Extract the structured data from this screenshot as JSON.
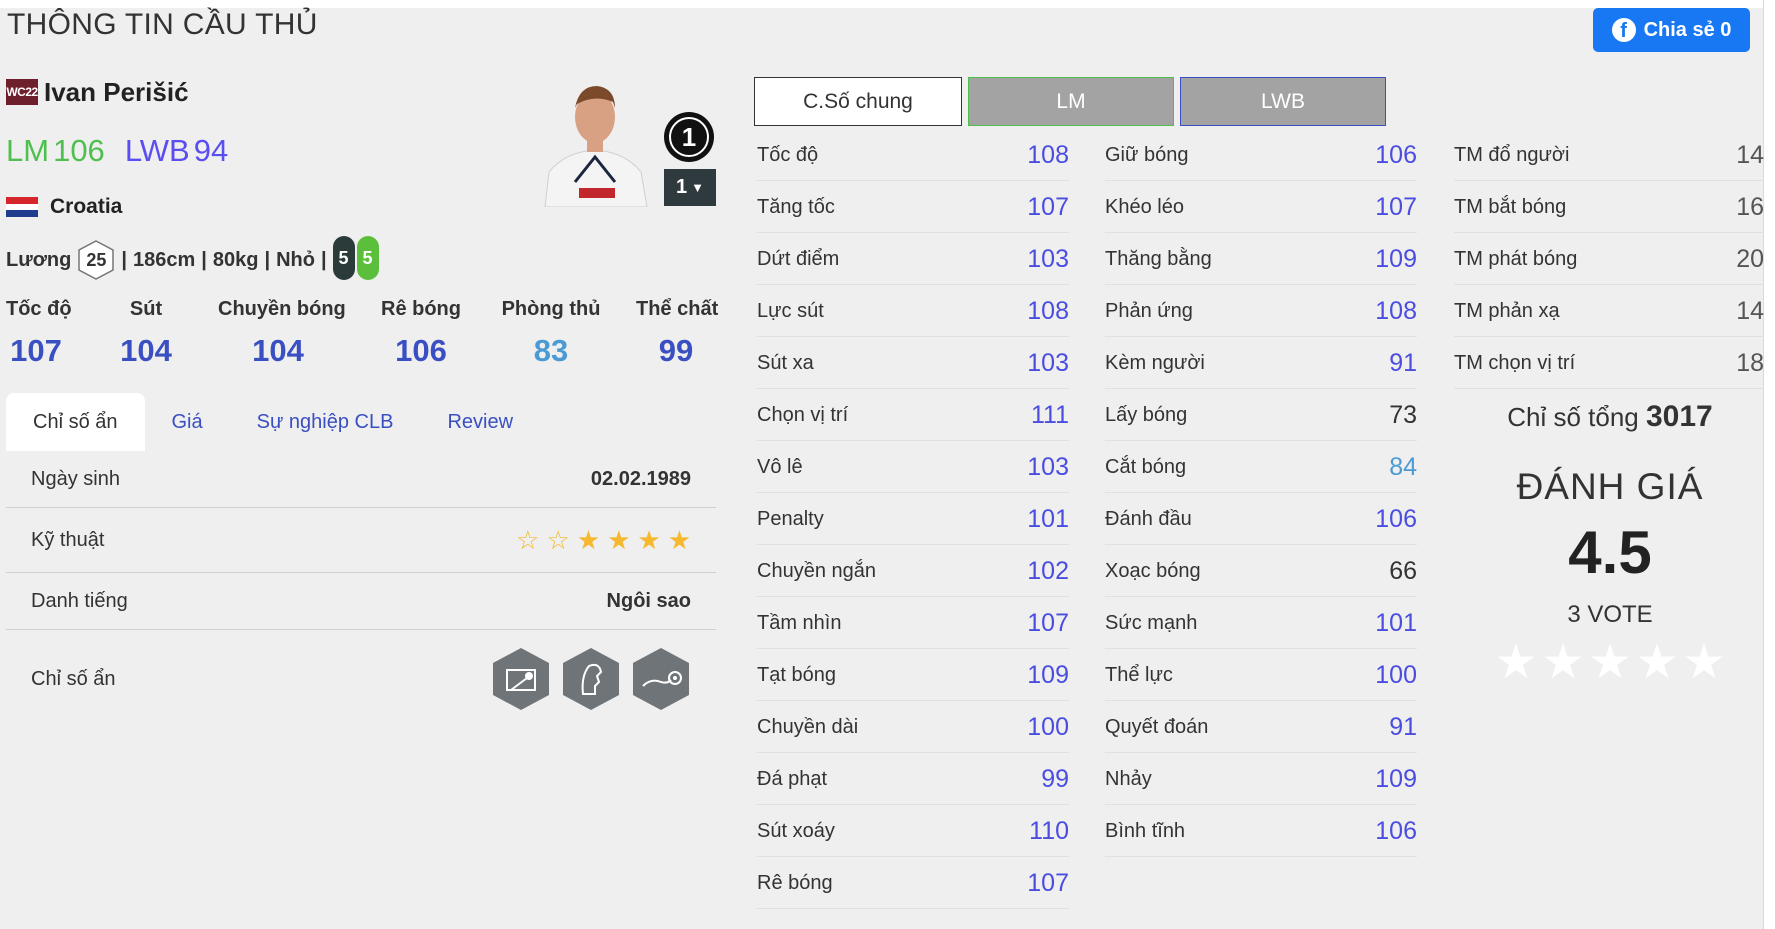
{
  "page_title": "THÔNG TIN CẦU THỦ",
  "share": {
    "label": "Chia sẻ 0"
  },
  "player": {
    "season": "WC22",
    "name": "Ivan Perišić",
    "positions": [
      {
        "pos": "LM",
        "rating": "106",
        "color": "#4fc04f"
      },
      {
        "pos": "LWB",
        "rating": "94",
        "color": "#5b4ef0"
      }
    ],
    "nation": "Croatia",
    "salary_label": "Lương",
    "salary": "25",
    "height": "186cm",
    "weight": "80kg",
    "body": "Nhỏ",
    "sep": "|",
    "foot_left": "5",
    "foot_right": "5",
    "rank": "1",
    "level": "1"
  },
  "main_stats": [
    {
      "label": "Tốc độ",
      "value": "107",
      "color": "#3a4fc1"
    },
    {
      "label": "Sút",
      "value": "104",
      "color": "#3a4fc1"
    },
    {
      "label": "Chuyền bóng",
      "value": "104",
      "color": "#3a4fc1"
    },
    {
      "label": "Rê bóng",
      "value": "106",
      "color": "#3a4fc1"
    },
    {
      "label": "Phòng thủ",
      "value": "83",
      "color": "#4a9ad4"
    },
    {
      "label": "Thể chất",
      "value": "99",
      "color": "#3a4fc1"
    }
  ],
  "tabs": [
    "Chỉ số ẩn",
    "Giá",
    "Sự nghiệp CLB",
    "Review"
  ],
  "info": {
    "birth_label": "Ngày sinh",
    "birth": "02.02.1989",
    "skill_label": "Kỹ thuật",
    "skill_stars": 6,
    "skill_filled": 4,
    "fame_label": "Danh tiếng",
    "fame": "Ngôi sao",
    "hidden_label": "Chỉ số ẩn"
  },
  "pos_tabs": [
    "C.Số chung",
    "LM",
    "LWB"
  ],
  "stats_col1": [
    {
      "label": "Tốc độ",
      "value": "108",
      "color": "#4a4de0"
    },
    {
      "label": "Tăng tốc",
      "value": "107",
      "color": "#4a4de0"
    },
    {
      "label": "Dứt điểm",
      "value": "103",
      "color": "#4a4de0"
    },
    {
      "label": "Lực sút",
      "value": "108",
      "color": "#4a4de0"
    },
    {
      "label": "Sút xa",
      "value": "103",
      "color": "#4a4de0"
    },
    {
      "label": "Chọn vị trí",
      "value": "111",
      "color": "#4a4de0"
    },
    {
      "label": "Vô lê",
      "value": "103",
      "color": "#4a4de0"
    },
    {
      "label": "Penalty",
      "value": "101",
      "color": "#4a4de0"
    },
    {
      "label": "Chuyền ngắn",
      "value": "102",
      "color": "#4a4de0"
    },
    {
      "label": "Tầm nhìn",
      "value": "107",
      "color": "#4a4de0"
    },
    {
      "label": "Tạt bóng",
      "value": "109",
      "color": "#4a4de0"
    },
    {
      "label": "Chuyền dài",
      "value": "100",
      "color": "#4a4de0"
    },
    {
      "label": "Đá phạt",
      "value": "99",
      "color": "#4a4de0"
    },
    {
      "label": "Sút xoáy",
      "value": "110",
      "color": "#4a4de0"
    },
    {
      "label": "Rê bóng",
      "value": "107",
      "color": "#4a4de0"
    }
  ],
  "stats_col2": [
    {
      "label": "Giữ bóng",
      "value": "106",
      "color": "#4a4de0"
    },
    {
      "label": "Khéo léo",
      "value": "107",
      "color": "#4a4de0"
    },
    {
      "label": "Thăng bằng",
      "value": "109",
      "color": "#4a4de0"
    },
    {
      "label": "Phản ứng",
      "value": "108",
      "color": "#4a4de0"
    },
    {
      "label": "Kèm người",
      "value": "91",
      "color": "#4a4de0"
    },
    {
      "label": "Lấy bóng",
      "value": "73",
      "color": "#333333"
    },
    {
      "label": "Cắt bóng",
      "value": "84",
      "color": "#4a9ad4"
    },
    {
      "label": "Đánh đầu",
      "value": "106",
      "color": "#4a4de0"
    },
    {
      "label": "Xoạc bóng",
      "value": "66",
      "color": "#333333"
    },
    {
      "label": "Sức mạnh",
      "value": "101",
      "color": "#4a4de0"
    },
    {
      "label": "Thể lực",
      "value": "100",
      "color": "#4a4de0"
    },
    {
      "label": "Quyết đoán",
      "value": "91",
      "color": "#4a4de0"
    },
    {
      "label": "Nhảy",
      "value": "109",
      "color": "#4a4de0"
    },
    {
      "label": "Bình tĩnh",
      "value": "106",
      "color": "#4a4de0"
    }
  ],
  "stats_col3": [
    {
      "label": "TM đổ người",
      "value": "14",
      "color": "#555555"
    },
    {
      "label": "TM bắt bóng",
      "value": "16",
      "color": "#555555"
    },
    {
      "label": "TM phát bóng",
      "value": "20",
      "color": "#555555"
    },
    {
      "label": "TM phản xạ",
      "value": "14",
      "color": "#555555"
    },
    {
      "label": "TM chọn vị trí",
      "value": "18",
      "color": "#555555"
    }
  ],
  "summary": {
    "total_label": "Chỉ số tổng",
    "total": "3017",
    "rating_title": "ĐÁNH GIÁ",
    "rating": "4.5",
    "votes": "3 VOTE",
    "rating_stars": 5
  }
}
